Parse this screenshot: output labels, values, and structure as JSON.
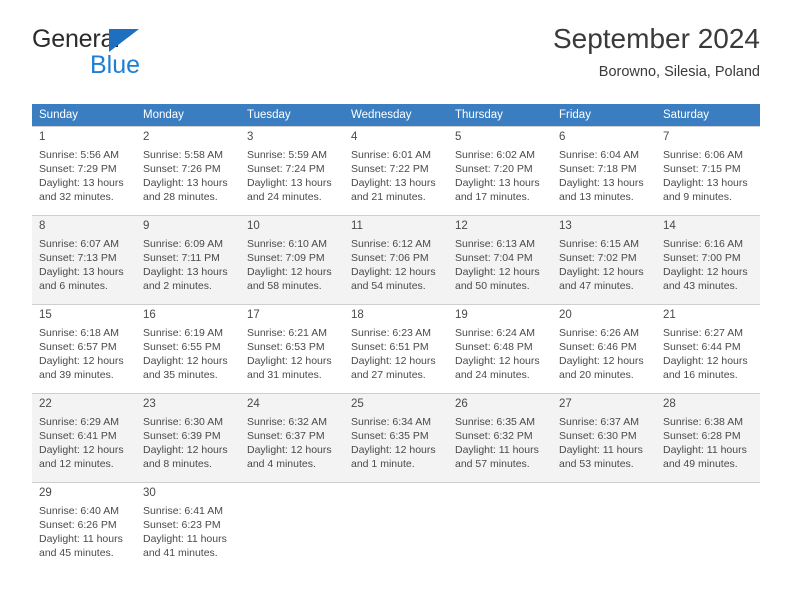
{
  "brand": {
    "line1": "General",
    "line2": "Blue",
    "triangle_color": "#1f6fc0",
    "text_color": "#2b2b2b",
    "blue_color": "#1d7fd4"
  },
  "header": {
    "title": "September 2024",
    "subtitle": "Borowno, Silesia, Poland"
  },
  "theme": {
    "header_bg": "#3a7ec1",
    "header_text": "#ffffff",
    "shaded_row_bg": "#f3f3f3",
    "grid_line": "#cfcfcf",
    "body_text": "#4a4a4a"
  },
  "weekdays": [
    "Sunday",
    "Monday",
    "Tuesday",
    "Wednesday",
    "Thursday",
    "Friday",
    "Saturday"
  ],
  "weeks": [
    {
      "shaded": false,
      "days": [
        {
          "num": "1",
          "sunrise": "Sunrise: 5:56 AM",
          "sunset": "Sunset: 7:29 PM",
          "daylight1": "Daylight: 13 hours",
          "daylight2": "and 32 minutes."
        },
        {
          "num": "2",
          "sunrise": "Sunrise: 5:58 AM",
          "sunset": "Sunset: 7:26 PM",
          "daylight1": "Daylight: 13 hours",
          "daylight2": "and 28 minutes."
        },
        {
          "num": "3",
          "sunrise": "Sunrise: 5:59 AM",
          "sunset": "Sunset: 7:24 PM",
          "daylight1": "Daylight: 13 hours",
          "daylight2": "and 24 minutes."
        },
        {
          "num": "4",
          "sunrise": "Sunrise: 6:01 AM",
          "sunset": "Sunset: 7:22 PM",
          "daylight1": "Daylight: 13 hours",
          "daylight2": "and 21 minutes."
        },
        {
          "num": "5",
          "sunrise": "Sunrise: 6:02 AM",
          "sunset": "Sunset: 7:20 PM",
          "daylight1": "Daylight: 13 hours",
          "daylight2": "and 17 minutes."
        },
        {
          "num": "6",
          "sunrise": "Sunrise: 6:04 AM",
          "sunset": "Sunset: 7:18 PM",
          "daylight1": "Daylight: 13 hours",
          "daylight2": "and 13 minutes."
        },
        {
          "num": "7",
          "sunrise": "Sunrise: 6:06 AM",
          "sunset": "Sunset: 7:15 PM",
          "daylight1": "Daylight: 13 hours",
          "daylight2": "and 9 minutes."
        }
      ]
    },
    {
      "shaded": true,
      "days": [
        {
          "num": "8",
          "sunrise": "Sunrise: 6:07 AM",
          "sunset": "Sunset: 7:13 PM",
          "daylight1": "Daylight: 13 hours",
          "daylight2": "and 6 minutes."
        },
        {
          "num": "9",
          "sunrise": "Sunrise: 6:09 AM",
          "sunset": "Sunset: 7:11 PM",
          "daylight1": "Daylight: 13 hours",
          "daylight2": "and 2 minutes."
        },
        {
          "num": "10",
          "sunrise": "Sunrise: 6:10 AM",
          "sunset": "Sunset: 7:09 PM",
          "daylight1": "Daylight: 12 hours",
          "daylight2": "and 58 minutes."
        },
        {
          "num": "11",
          "sunrise": "Sunrise: 6:12 AM",
          "sunset": "Sunset: 7:06 PM",
          "daylight1": "Daylight: 12 hours",
          "daylight2": "and 54 minutes."
        },
        {
          "num": "12",
          "sunrise": "Sunrise: 6:13 AM",
          "sunset": "Sunset: 7:04 PM",
          "daylight1": "Daylight: 12 hours",
          "daylight2": "and 50 minutes."
        },
        {
          "num": "13",
          "sunrise": "Sunrise: 6:15 AM",
          "sunset": "Sunset: 7:02 PM",
          "daylight1": "Daylight: 12 hours",
          "daylight2": "and 47 minutes."
        },
        {
          "num": "14",
          "sunrise": "Sunrise: 6:16 AM",
          "sunset": "Sunset: 7:00 PM",
          "daylight1": "Daylight: 12 hours",
          "daylight2": "and 43 minutes."
        }
      ]
    },
    {
      "shaded": false,
      "days": [
        {
          "num": "15",
          "sunrise": "Sunrise: 6:18 AM",
          "sunset": "Sunset: 6:57 PM",
          "daylight1": "Daylight: 12 hours",
          "daylight2": "and 39 minutes."
        },
        {
          "num": "16",
          "sunrise": "Sunrise: 6:19 AM",
          "sunset": "Sunset: 6:55 PM",
          "daylight1": "Daylight: 12 hours",
          "daylight2": "and 35 minutes."
        },
        {
          "num": "17",
          "sunrise": "Sunrise: 6:21 AM",
          "sunset": "Sunset: 6:53 PM",
          "daylight1": "Daylight: 12 hours",
          "daylight2": "and 31 minutes."
        },
        {
          "num": "18",
          "sunrise": "Sunrise: 6:23 AM",
          "sunset": "Sunset: 6:51 PM",
          "daylight1": "Daylight: 12 hours",
          "daylight2": "and 27 minutes."
        },
        {
          "num": "19",
          "sunrise": "Sunrise: 6:24 AM",
          "sunset": "Sunset: 6:48 PM",
          "daylight1": "Daylight: 12 hours",
          "daylight2": "and 24 minutes."
        },
        {
          "num": "20",
          "sunrise": "Sunrise: 6:26 AM",
          "sunset": "Sunset: 6:46 PM",
          "daylight1": "Daylight: 12 hours",
          "daylight2": "and 20 minutes."
        },
        {
          "num": "21",
          "sunrise": "Sunrise: 6:27 AM",
          "sunset": "Sunset: 6:44 PM",
          "daylight1": "Daylight: 12 hours",
          "daylight2": "and 16 minutes."
        }
      ]
    },
    {
      "shaded": true,
      "days": [
        {
          "num": "22",
          "sunrise": "Sunrise: 6:29 AM",
          "sunset": "Sunset: 6:41 PM",
          "daylight1": "Daylight: 12 hours",
          "daylight2": "and 12 minutes."
        },
        {
          "num": "23",
          "sunrise": "Sunrise: 6:30 AM",
          "sunset": "Sunset: 6:39 PM",
          "daylight1": "Daylight: 12 hours",
          "daylight2": "and 8 minutes."
        },
        {
          "num": "24",
          "sunrise": "Sunrise: 6:32 AM",
          "sunset": "Sunset: 6:37 PM",
          "daylight1": "Daylight: 12 hours",
          "daylight2": "and 4 minutes."
        },
        {
          "num": "25",
          "sunrise": "Sunrise: 6:34 AM",
          "sunset": "Sunset: 6:35 PM",
          "daylight1": "Daylight: 12 hours",
          "daylight2": "and 1 minute."
        },
        {
          "num": "26",
          "sunrise": "Sunrise: 6:35 AM",
          "sunset": "Sunset: 6:32 PM",
          "daylight1": "Daylight: 11 hours",
          "daylight2": "and 57 minutes."
        },
        {
          "num": "27",
          "sunrise": "Sunrise: 6:37 AM",
          "sunset": "Sunset: 6:30 PM",
          "daylight1": "Daylight: 11 hours",
          "daylight2": "and 53 minutes."
        },
        {
          "num": "28",
          "sunrise": "Sunrise: 6:38 AM",
          "sunset": "Sunset: 6:28 PM",
          "daylight1": "Daylight: 11 hours",
          "daylight2": "and 49 minutes."
        }
      ]
    },
    {
      "shaded": false,
      "days": [
        {
          "num": "29",
          "sunrise": "Sunrise: 6:40 AM",
          "sunset": "Sunset: 6:26 PM",
          "daylight1": "Daylight: 11 hours",
          "daylight2": "and 45 minutes."
        },
        {
          "num": "30",
          "sunrise": "Sunrise: 6:41 AM",
          "sunset": "Sunset: 6:23 PM",
          "daylight1": "Daylight: 11 hours",
          "daylight2": "and 41 minutes."
        },
        {
          "num": "",
          "sunrise": "",
          "sunset": "",
          "daylight1": "",
          "daylight2": ""
        },
        {
          "num": "",
          "sunrise": "",
          "sunset": "",
          "daylight1": "",
          "daylight2": ""
        },
        {
          "num": "",
          "sunrise": "",
          "sunset": "",
          "daylight1": "",
          "daylight2": ""
        },
        {
          "num": "",
          "sunrise": "",
          "sunset": "",
          "daylight1": "",
          "daylight2": ""
        },
        {
          "num": "",
          "sunrise": "",
          "sunset": "",
          "daylight1": "",
          "daylight2": ""
        }
      ]
    }
  ]
}
